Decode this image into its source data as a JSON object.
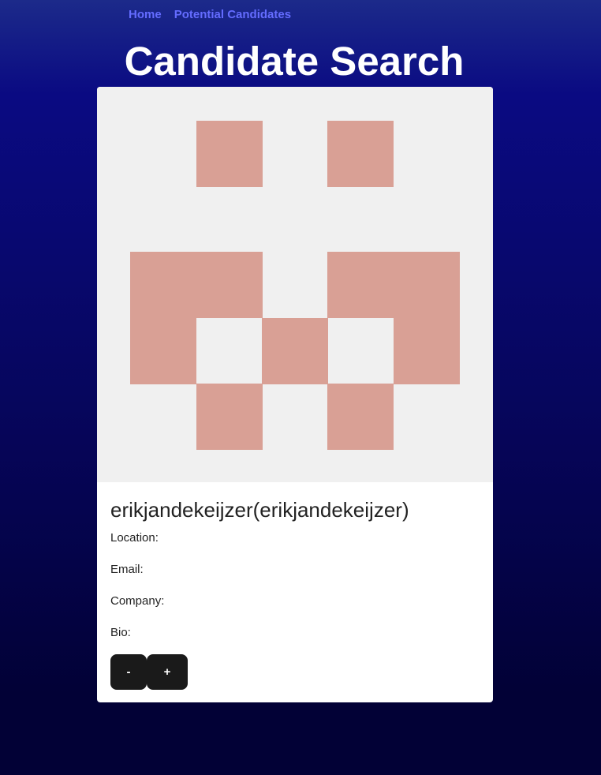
{
  "nav": {
    "home_label": "Home",
    "potential_label": "Potential Candidates"
  },
  "header": {
    "title": "Candidate Search"
  },
  "candidate": {
    "name": "erikjandekeijzer(erikjandekeijzer)",
    "location_label": "Location:",
    "email_label": "Email:",
    "company_label": "Company:",
    "bio_label": "Bio:"
  },
  "actions": {
    "reject_label": "-",
    "accept_label": "+"
  },
  "avatar": {
    "icon": "identicon",
    "background_color": "#f0f0f0",
    "pattern_color": "#d9a095"
  }
}
